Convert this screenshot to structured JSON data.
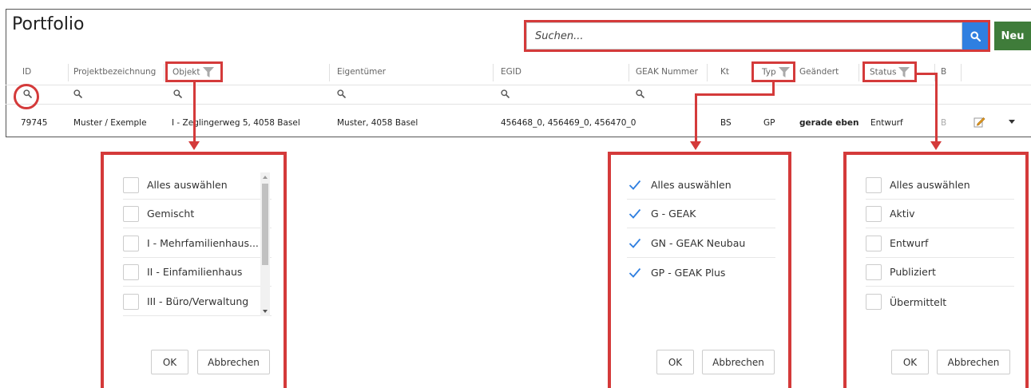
{
  "header": {
    "title": "Portfolio"
  },
  "search": {
    "placeholder": "Suchen...",
    "new_label": "Neu"
  },
  "columns": {
    "id": "ID",
    "projekt": "Projektbezeichnung",
    "objekt": "Objekt",
    "eigentuemer": "Eigentümer",
    "egid": "EGID",
    "geak": "GEAK Nummer",
    "kt": "Kt",
    "typ": "Typ",
    "geaendert": "Geändert",
    "status": "Status",
    "b": "B"
  },
  "row": {
    "id": "79745",
    "projekt": "Muster / Exemple",
    "objekt": "I - Zeglingerweg 5, 4058 Basel",
    "eigentuemer": "Muster, 4058 Basel",
    "egid": "456468_0, 456469_0, 456470_0",
    "kt": "BS",
    "typ": "GP",
    "geaendert": "gerade eben",
    "status": "Entwurf",
    "b": "B"
  },
  "objekt_filter": {
    "items": [
      "Alles auswählen",
      "Gemischt",
      "I - Mehrfamilienhaus...",
      "II - Einfamilienhaus",
      "III - Büro/Verwaltung"
    ],
    "ok": "OK",
    "cancel": "Abbrechen"
  },
  "typ_filter": {
    "items": [
      "Alles auswählen",
      "G - GEAK",
      "GN - GEAK Neubau",
      "GP - GEAK Plus"
    ],
    "ok": "OK",
    "cancel": "Abbrechen"
  },
  "status_filter": {
    "items": [
      "Alles auswählen",
      "Aktiv",
      "Entwurf",
      "Publiziert",
      "Übermittelt"
    ],
    "ok": "OK",
    "cancel": "Abbrechen"
  },
  "colors": {
    "highlight": "#d43a3a",
    "search_button": "#2f7fe0",
    "new_button": "#3f7c3a",
    "check": "#2f7fe0"
  }
}
